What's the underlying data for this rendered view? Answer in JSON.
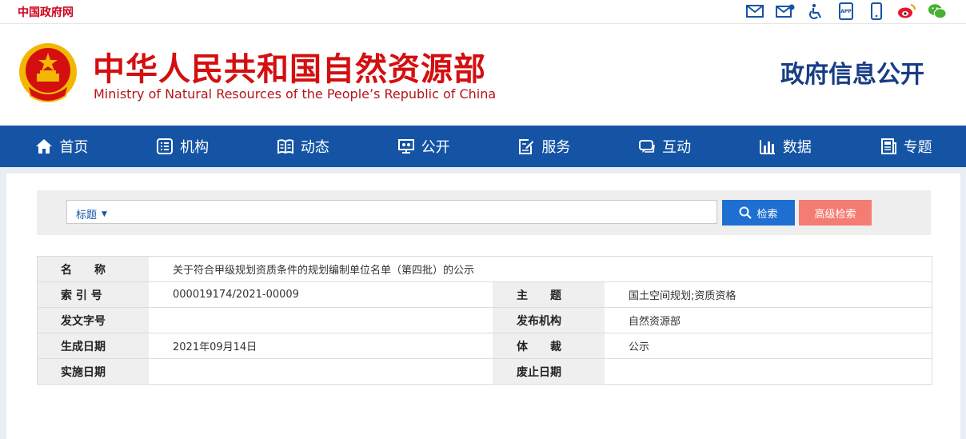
{
  "topbar": {
    "site_link": "中国政府网",
    "icons": [
      "mail-icon",
      "mail-settings-icon",
      "accessibility-icon",
      "app-icon",
      "mobile-icon",
      "weibo-icon",
      "wechat-icon"
    ]
  },
  "header": {
    "title_cn": "中华人民共和国自然资源部",
    "title_en": "Ministry of Natural Resources of the People’s Republic of China",
    "gov_info": "政府信息公开"
  },
  "nav": {
    "items": [
      {
        "label": "首页",
        "icon": "home-icon"
      },
      {
        "label": "机构",
        "icon": "org-icon"
      },
      {
        "label": "动态",
        "icon": "book-icon"
      },
      {
        "label": "公开",
        "icon": "screen-icon"
      },
      {
        "label": "服务",
        "icon": "edit-doc-icon"
      },
      {
        "label": "互动",
        "icon": "chat-icon"
      },
      {
        "label": "数据",
        "icon": "bar-chart-icon"
      },
      {
        "label": "专题",
        "icon": "newspaper-icon"
      }
    ]
  },
  "search": {
    "type_label": "标题",
    "placeholder": "",
    "search_label": "检索",
    "advanced_label": "高级检索"
  },
  "info": {
    "name_label": "名　　称",
    "name_value": "关于符合甲级规划资质条件的规划编制单位名单（第四批）的公示",
    "rows": [
      {
        "l1": "索 引 号",
        "v1": "000019174/2021-00009",
        "l2": "主　　题",
        "v2": "国土空间规划;资质资格"
      },
      {
        "l1": "发文字号",
        "v1": "",
        "l2": "发布机构",
        "v2": "自然资源部"
      },
      {
        "l1": "生成日期",
        "v1": "2021年09月14日",
        "l2": "体　　裁",
        "v2": "公示"
      },
      {
        "l1": "实施日期",
        "v1": "",
        "l2": "废止日期",
        "v2": ""
      }
    ]
  },
  "colors": {
    "nav_bg": "#1554a5",
    "title_red": "#d40f0f",
    "gov_info_blue": "#173d84",
    "search_btn": "#1e6fd1",
    "advanced_btn": "#f57c73"
  }
}
